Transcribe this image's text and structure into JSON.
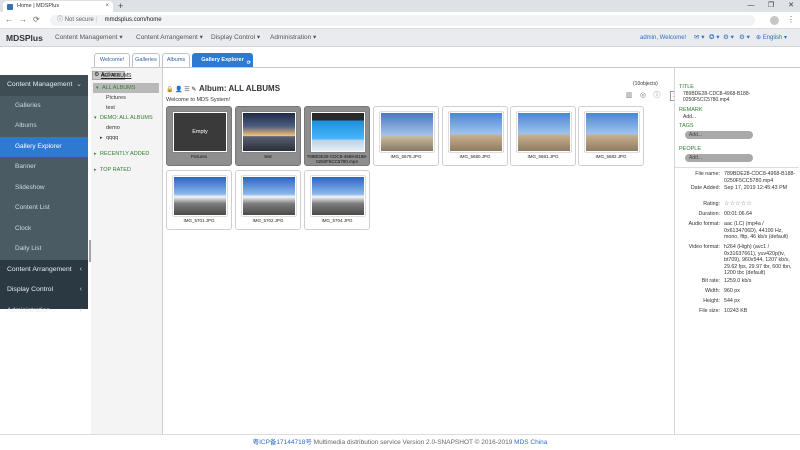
{
  "browser": {
    "tab_title": "Home | MDSPlus",
    "tab_close": "×",
    "new_tab": "+",
    "security": "Not secure",
    "url": "mmdsplus.com/home",
    "window_controls": [
      "—",
      "❐",
      "✕"
    ],
    "nav": [
      "←",
      "→",
      "⟳"
    ],
    "menu_icon": "⋮"
  },
  "appnav": {
    "brand": "MDSPlus",
    "menus": [
      "Content Management ▾",
      "Content Arrangement ▾",
      "Display Control ▾",
      "Administration ▾"
    ],
    "user": "admin, Welcome!",
    "language": "English ▾",
    "icons": [
      "✉ ▾",
      "✪ ▾",
      "⚙ ▾",
      "⚙ ▾"
    ]
  },
  "sidebar": {
    "sections": [
      {
        "label": "Content Management",
        "arrow": "⌄"
      },
      {
        "label": "Content Arrangement",
        "arrow": "‹"
      },
      {
        "label": "Display Control",
        "arrow": "‹"
      },
      {
        "label": "Administration",
        "arrow": "‹"
      }
    ],
    "items": [
      "Galleries",
      "Albums",
      "Gallery Explorer",
      "Banner",
      "Slideshow",
      "Content List",
      "Clock",
      "Daily List"
    ]
  },
  "subtabs": [
    "Welcome!",
    "Galleries",
    "Albums",
    "Gallery Explorer"
  ],
  "tree": {
    "actions": "Actions",
    "breadcrumb": "ALL ALBUMS",
    "nodes": [
      "ALL ALBUMS",
      "Pictures",
      "test",
      "DEMO: ALL ALBUMS",
      "demo",
      "qqqq",
      "RECENTLY ADDED",
      "TOP RATED"
    ]
  },
  "album": {
    "title": "Album: ALL ALBUMS",
    "welcome": "Welcome to MDS System!",
    "count": "(10objects)",
    "page": "1",
    "empty_label": "Empty",
    "items": [
      {
        "caption": "Pictures",
        "kind": "album-empty"
      },
      {
        "caption": "test",
        "kind": "album-sunrise"
      },
      {
        "caption": "789BDE28-CDC8-4968-B188-0250F5CC5780.mp4",
        "kind": "video-pool"
      },
      {
        "caption": "IMG_5678.JPG",
        "kind": "desertcar"
      },
      {
        "caption": "IMG_5680.JPG",
        "kind": "desert"
      },
      {
        "caption": "IMG_5681.JPG",
        "kind": "desert"
      },
      {
        "caption": "IMG_5682.JPG",
        "kind": "desert"
      },
      {
        "caption": "IMG_5701.JPG",
        "kind": "mountain"
      },
      {
        "caption": "IMG_5702.JPG",
        "kind": "mountain"
      },
      {
        "caption": "IMG_5704.JPG",
        "kind": "mountain"
      }
    ]
  },
  "info": {
    "title_label": "TITLE",
    "title_value": "789BDE28-CDC8-4968-B188-0250F5CC5780.mp4",
    "remark_label": "REMARK",
    "remark_value": "Add...",
    "tags_label": "TAGS",
    "tags_add": "Add...",
    "people_label": "PEOPLE",
    "people_add": "Add...",
    "meta": [
      {
        "k": "File name:",
        "v": "789BDE28-CDC8-4968-B188-0250F5CC5780.mp4"
      },
      {
        "k": "Date Added:",
        "v": "Sep 17, 2019 12:45:43 PM"
      },
      {
        "k": "Rating:",
        "v": "☆☆☆☆☆"
      },
      {
        "k": "Duration:",
        "v": "00:01:06.64"
      },
      {
        "k": "Audio format:",
        "v": "aac (LC) (mp4a / 0x6134706D), 44100 Hz, mono, fltp, 46 kb/s (default)"
      },
      {
        "k": "Video format:",
        "v": "h264 (High) (avc1 / 0x31637661), yuv420p(tv, bt709), 960x544, 1207 kb/s, 29.62 fps, 29.97 tbr, 600 tbn, 1200 tbc (default)"
      },
      {
        "k": "Bit rate:",
        "v": "1259.0 kb/s"
      },
      {
        "k": "Width:",
        "v": "960 px"
      },
      {
        "k": "Height:",
        "v": "544 px"
      },
      {
        "k": "File size:",
        "v": "10243 KB"
      }
    ]
  },
  "footer": {
    "icp": "粤ICP备17144718号",
    "text": " Multimedia distribution service Version 2.0-SNAPSHOT © 2016-2019 ",
    "company": "MDS China"
  },
  "colors": {
    "sidebar": "#2b3a42",
    "active": "#2e7ad1",
    "label_green": "#2f7d32"
  }
}
